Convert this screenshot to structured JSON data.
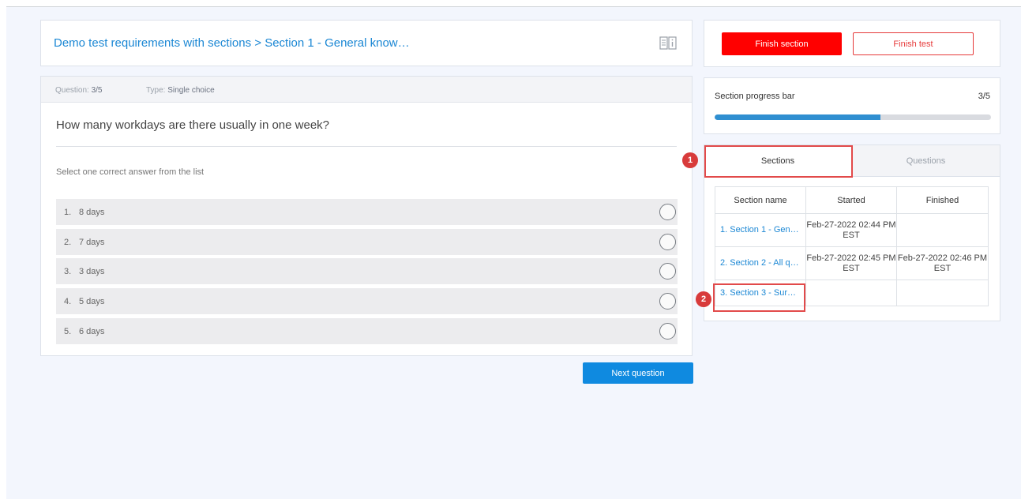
{
  "header": {
    "breadcrumb": "Demo test requirements with sections > Section 1 - General know…"
  },
  "question": {
    "meta_question_label": "Question:",
    "meta_question_value": "3/5",
    "meta_type_label": "Type:",
    "meta_type_value": "Single choice",
    "text": "How many workdays are there usually in one week?",
    "instruction": "Select one correct answer from the list",
    "options": [
      {
        "num": "1.",
        "label": "8 days"
      },
      {
        "num": "2.",
        "label": "7 days"
      },
      {
        "num": "3.",
        "label": "3 days"
      },
      {
        "num": "4.",
        "label": "5 days"
      },
      {
        "num": "5.",
        "label": "6 days"
      }
    ]
  },
  "next_button": "Next question",
  "actions": {
    "finish_section": "Finish section",
    "finish_test": "Finish test"
  },
  "progress": {
    "label": "Section progress bar",
    "count": "3/5",
    "fraction": 0.6
  },
  "tabs": {
    "sections": "Sections",
    "questions": "Questions"
  },
  "sections_table": {
    "headers": [
      "Section name",
      "Started",
      "Finished"
    ],
    "rows": [
      {
        "name": "1. Section 1 - Gen…",
        "started": "Feb-27-2022 02:44 PM EST",
        "finished": ""
      },
      {
        "name": "2. Section 2 - All q…",
        "started": "Feb-27-2022 02:45 PM EST",
        "finished": "Feb-27-2022 02:46 PM EST"
      },
      {
        "name": "3. Section 3 - Sur…",
        "started": "",
        "finished": ""
      }
    ]
  },
  "markers": [
    "1",
    "2"
  ],
  "colors": {
    "accent": "#1b87d4",
    "primary_button": "#0f8ae0",
    "danger": "#ff0000",
    "progress_fill": "#2f8fd1",
    "background": "#f3f6fd"
  }
}
